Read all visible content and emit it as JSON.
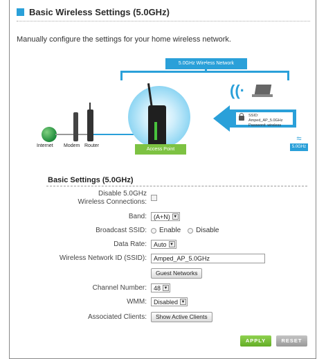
{
  "page": {
    "title": "Basic Wireless Settings (5.0GHz)",
    "intro": "Manually configure the settings for your home wireless network."
  },
  "diagram": {
    "network_label": "5.0GHz Wireless Network",
    "internet_label": "Internet",
    "modem_label": "Modem",
    "router_label": "Router",
    "access_point_label": "Access Point",
    "ssid_line": "SSID: Amped_AP_5.0GHz",
    "password_line": "Password: wireless",
    "band_badge": "5.0GHz"
  },
  "settings": {
    "section_title": "Basic Settings (5.0GHz)",
    "disable_label": "Disable 5.0GHz Wireless Connections:",
    "disable_checked": false,
    "band_label": "Band:",
    "band_value": "(A+N)",
    "broadcast_label": "Broadcast SSID:",
    "broadcast_enable": "Enable",
    "broadcast_disable": "Disable",
    "data_rate_label": "Data Rate:",
    "data_rate_value": "Auto",
    "ssid_label": "Wireless Network ID (SSID):",
    "ssid_value": "Amped_AP_5.0GHz",
    "guest_networks_button": "Guest Networks",
    "channel_label": "Channel Number:",
    "channel_value": "48",
    "wmm_label": "WMM:",
    "wmm_value": "Disabled",
    "clients_label": "Associated Clients:",
    "clients_button": "Show Active Clients"
  },
  "actions": {
    "apply": "APPLY",
    "reset": "RESET"
  },
  "colors": {
    "accent_blue": "#2aa0d9",
    "apply_green": "#7dc242",
    "reset_gray": "#aaaaaa"
  }
}
